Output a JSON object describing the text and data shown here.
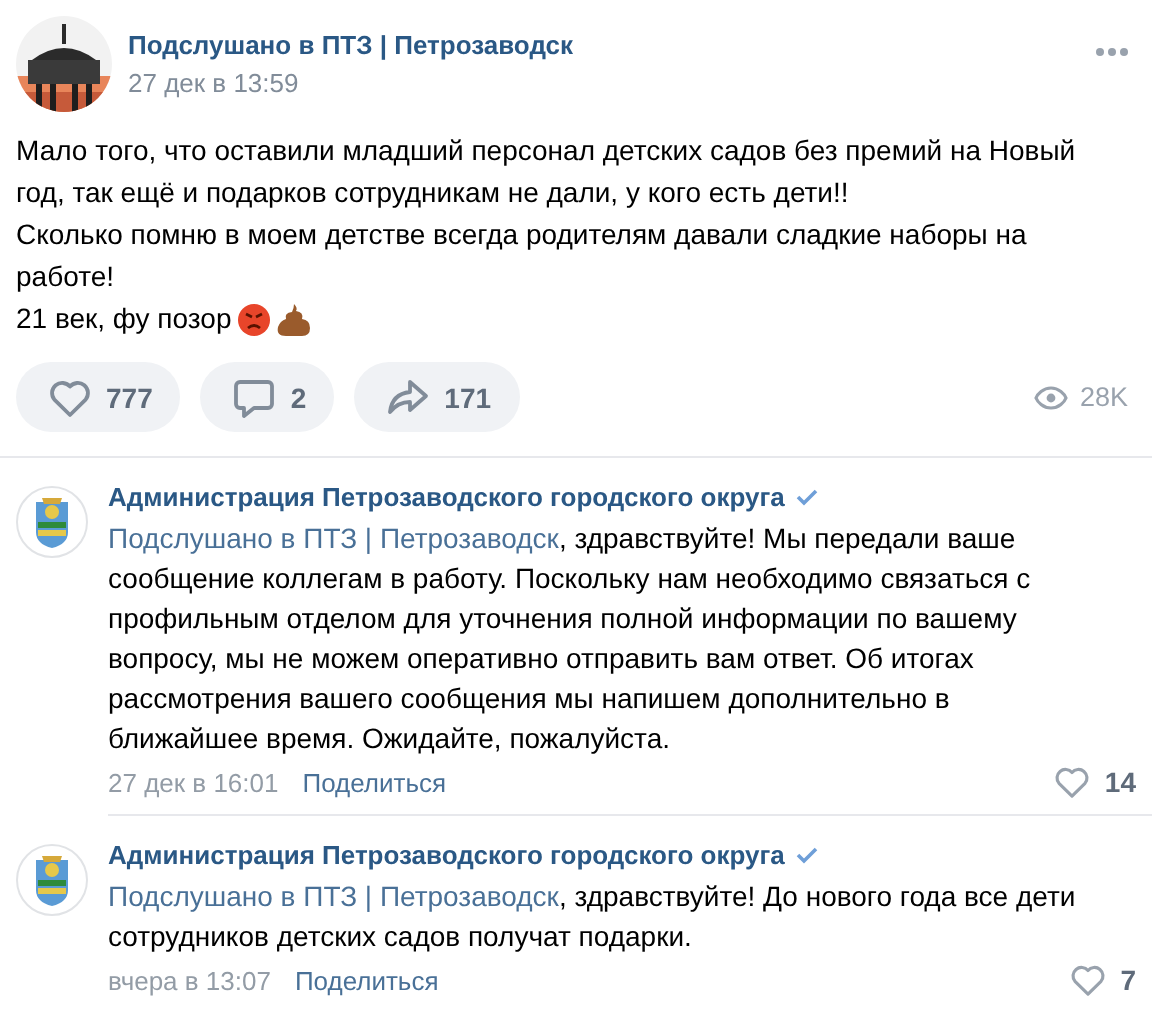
{
  "post": {
    "author": "Подслушано в ПТЗ | Петрозаводск",
    "date": "27 дек в 13:59",
    "text_lines": [
      "Мало того, что оставили младший персонал детских садов без премий на Новый год, так ещё и подарков сотрудникам не дали, у кого есть дети!!",
      "Сколько помню в моем детстве всегда родителям давали сладкие наборы на работе!",
      "21 век, фу позор"
    ],
    "actions": [
      {
        "kind": "like",
        "count": "777"
      },
      {
        "kind": "comment",
        "count": "2"
      },
      {
        "kind": "share",
        "count": "171"
      }
    ],
    "views": "28K"
  },
  "comments": [
    {
      "author": "Администрация Петрозаводского городского округа",
      "verified": true,
      "mention": "Подслушано в ПТЗ | Петрозаводск",
      "text": ", здравствуйте! Мы передали ваше сообщение коллегам в работу. Поскольку нам необходимо связаться с профильным отделом для уточнения полной информации по вашему вопросу, мы не можем оперативно отправить вам ответ. Об итогах рассмотрения вашего сообщения мы напишем дополнительно в ближайшее время. Ожидайте, пожалуйста.",
      "date": "27 дек в 16:01",
      "share": "Поделиться",
      "likes": "14"
    },
    {
      "author": "Администрация Петрозаводского городского округа",
      "verified": true,
      "mention": "Подслушано в ПТЗ | Петрозаводск",
      "text": ", здравствуйте! До нового года все дети сотрудников детских садов получат подарки.",
      "date": "вчера в 13:07",
      "share": "Поделиться",
      "likes": "7"
    }
  ]
}
